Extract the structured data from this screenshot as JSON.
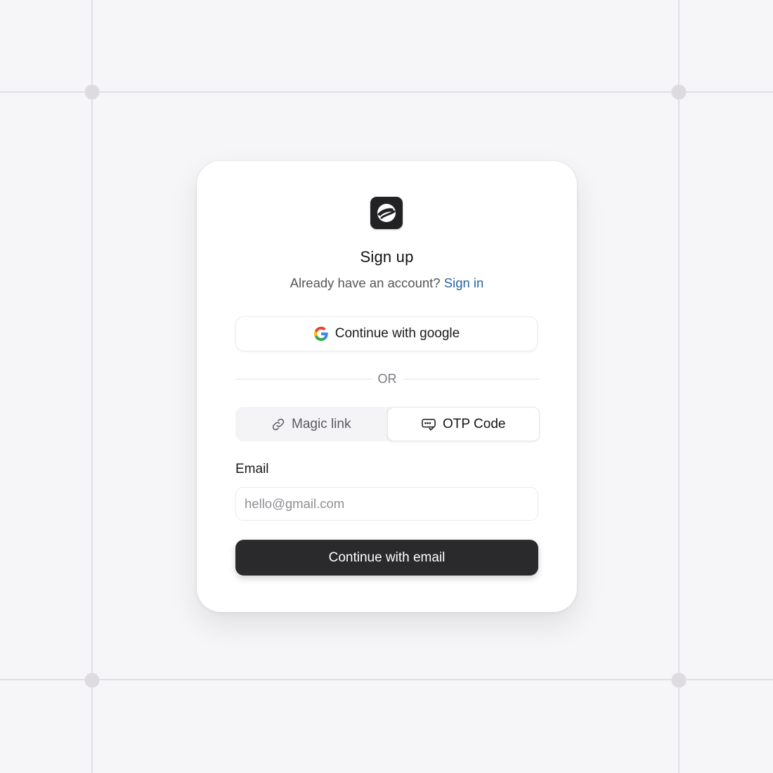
{
  "card": {
    "title": "Sign up",
    "subtitle_text": "Already have an account?",
    "signin_link": "Sign in"
  },
  "google_button": {
    "label": "Continue with google",
    "icon": "google-icon"
  },
  "divider": {
    "label": "OR"
  },
  "auth_methods": {
    "options": [
      {
        "label": "Magic link",
        "icon": "link-icon",
        "selected": false
      },
      {
        "label": "OTP Code",
        "icon": "otp-message-icon",
        "selected": true
      }
    ]
  },
  "email": {
    "label": "Email",
    "value": "",
    "placeholder": "hello@gmail.com"
  },
  "submit": {
    "label": "Continue with email"
  },
  "colors": {
    "background": "#f6f5f7",
    "card": "#ffffff",
    "primary_button": "#2a2a2d",
    "link": "#2563a6"
  }
}
